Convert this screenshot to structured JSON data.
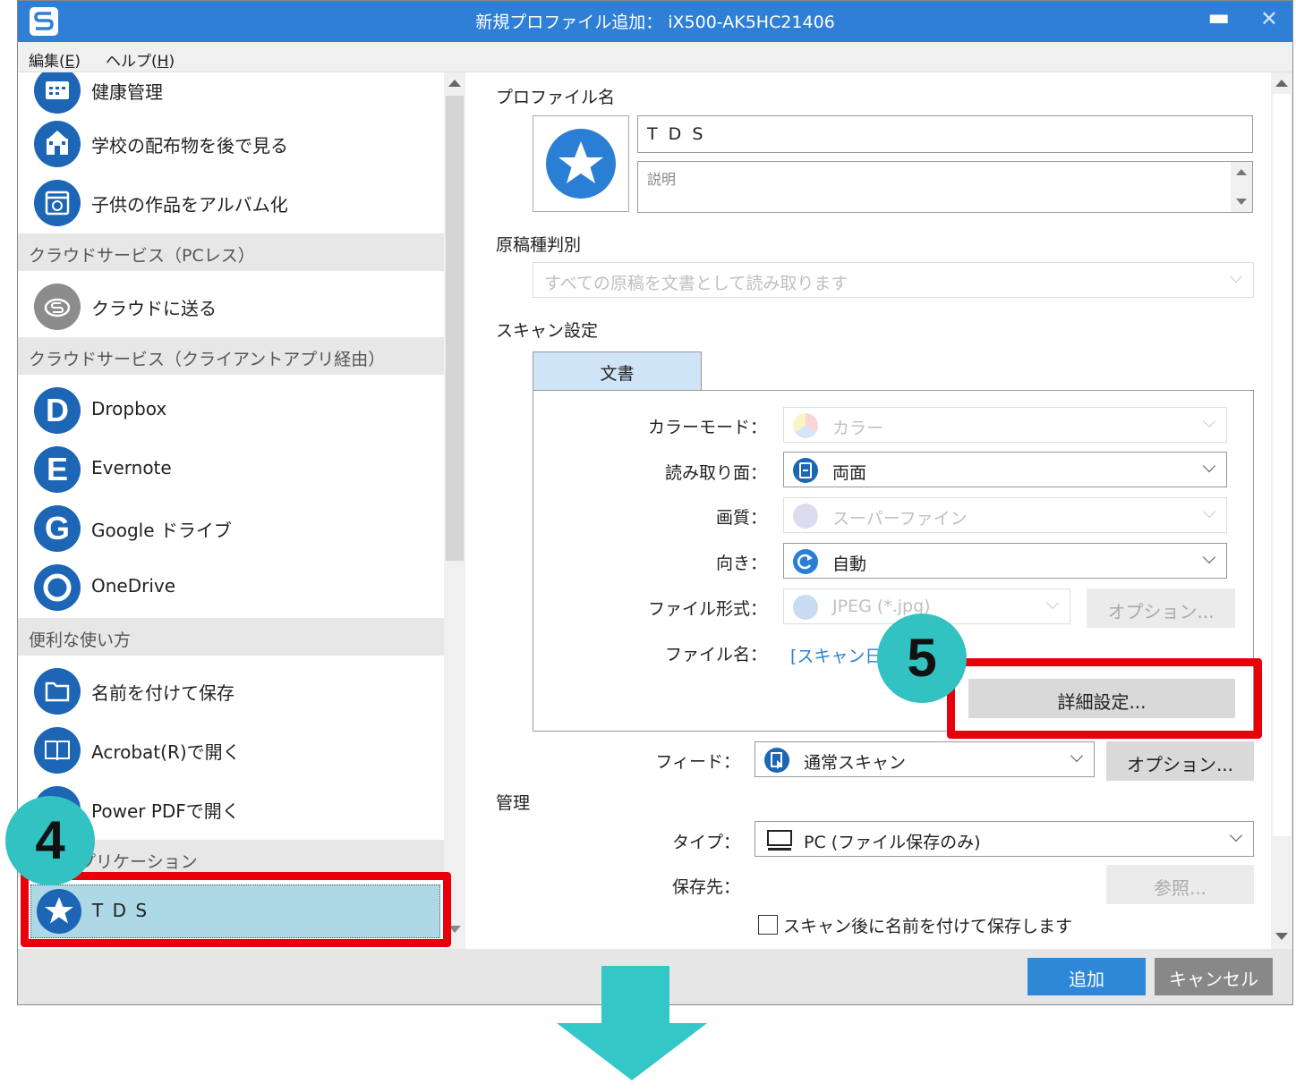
{
  "window": {
    "title": "新規プロファイル追加： iX500-AK5HC21406"
  },
  "menu": {
    "edit": "編集(",
    "edit_key": "E",
    "edit_close": ")",
    "help": "ヘルプ(",
    "help_key": "H",
    "help_close": ")"
  },
  "left_list": {
    "items": [
      {
        "label": "健康管理",
        "icon": "calendar-icon"
      },
      {
        "label": "学校の配布物を後で見る",
        "icon": "school-icon"
      },
      {
        "label": "子供の作品をアルバム化",
        "icon": "album-icon"
      }
    ],
    "section_cloud_pcless": "クラウドサービス（PCレス）",
    "cloud_send": "クラウドに送る",
    "section_cloud_client": "クラウドサービス（クライアントアプリ経由）",
    "cloud_apps": [
      "Dropbox",
      "Evernote",
      "Google ドライブ",
      "OneDrive"
    ],
    "cloud_letters": [
      "D",
      "E",
      "G",
      "O"
    ],
    "section_useful": "便利な使い方",
    "useful": [
      "名前を付けて保存",
      "Acrobat(R)で開く",
      "Power PDFで開く"
    ],
    "section_app": "アプリケーション",
    "section_app_visible": "プリケーション",
    "selected": "T D S"
  },
  "profile": {
    "name_label": "プロファイル名",
    "name_value": "T D S",
    "description_placeholder": "説明"
  },
  "doc_type": {
    "label": "原稿種判別",
    "value": "すべての原稿を文書として読み取ります"
  },
  "scan": {
    "label": "スキャン設定",
    "tab": "文書",
    "color_mode_label": "カラーモード：",
    "color_mode_value": "カラー",
    "side_label": "読み取り面：",
    "side_value": "両面",
    "quality_label": "画質：",
    "quality_value": "スーパーファイン",
    "orientation_label": "向き：",
    "orientation_value": "自動",
    "format_label": "ファイル形式：",
    "format_value": "JPEG (*.jpg)",
    "format_option": "オプション...",
    "filename_label": "ファイル名：",
    "filename_value": "[スキャン日",
    "advanced_button": "詳細設定...",
    "feed_label": "フィード：",
    "feed_value": "通常スキャン",
    "feed_option": "オプション..."
  },
  "manage": {
    "label": "管理",
    "type_label": "タイプ：",
    "type_value": "PC (ファイル保存のみ)",
    "dest_label": "保存先：",
    "browse": "参照...",
    "save_after_scan": "スキャン後に名前を付けて保存します"
  },
  "footer": {
    "add": "追加",
    "cancel": "キャンセル"
  },
  "annotations": {
    "step4": "4",
    "step5": "5"
  },
  "colors": {
    "titlebar": "#2f7fd6",
    "accent": "#1c66b5",
    "highlight": "#e8000b",
    "step_badge": "#33c2c2",
    "selected_row": "#add8e6"
  }
}
